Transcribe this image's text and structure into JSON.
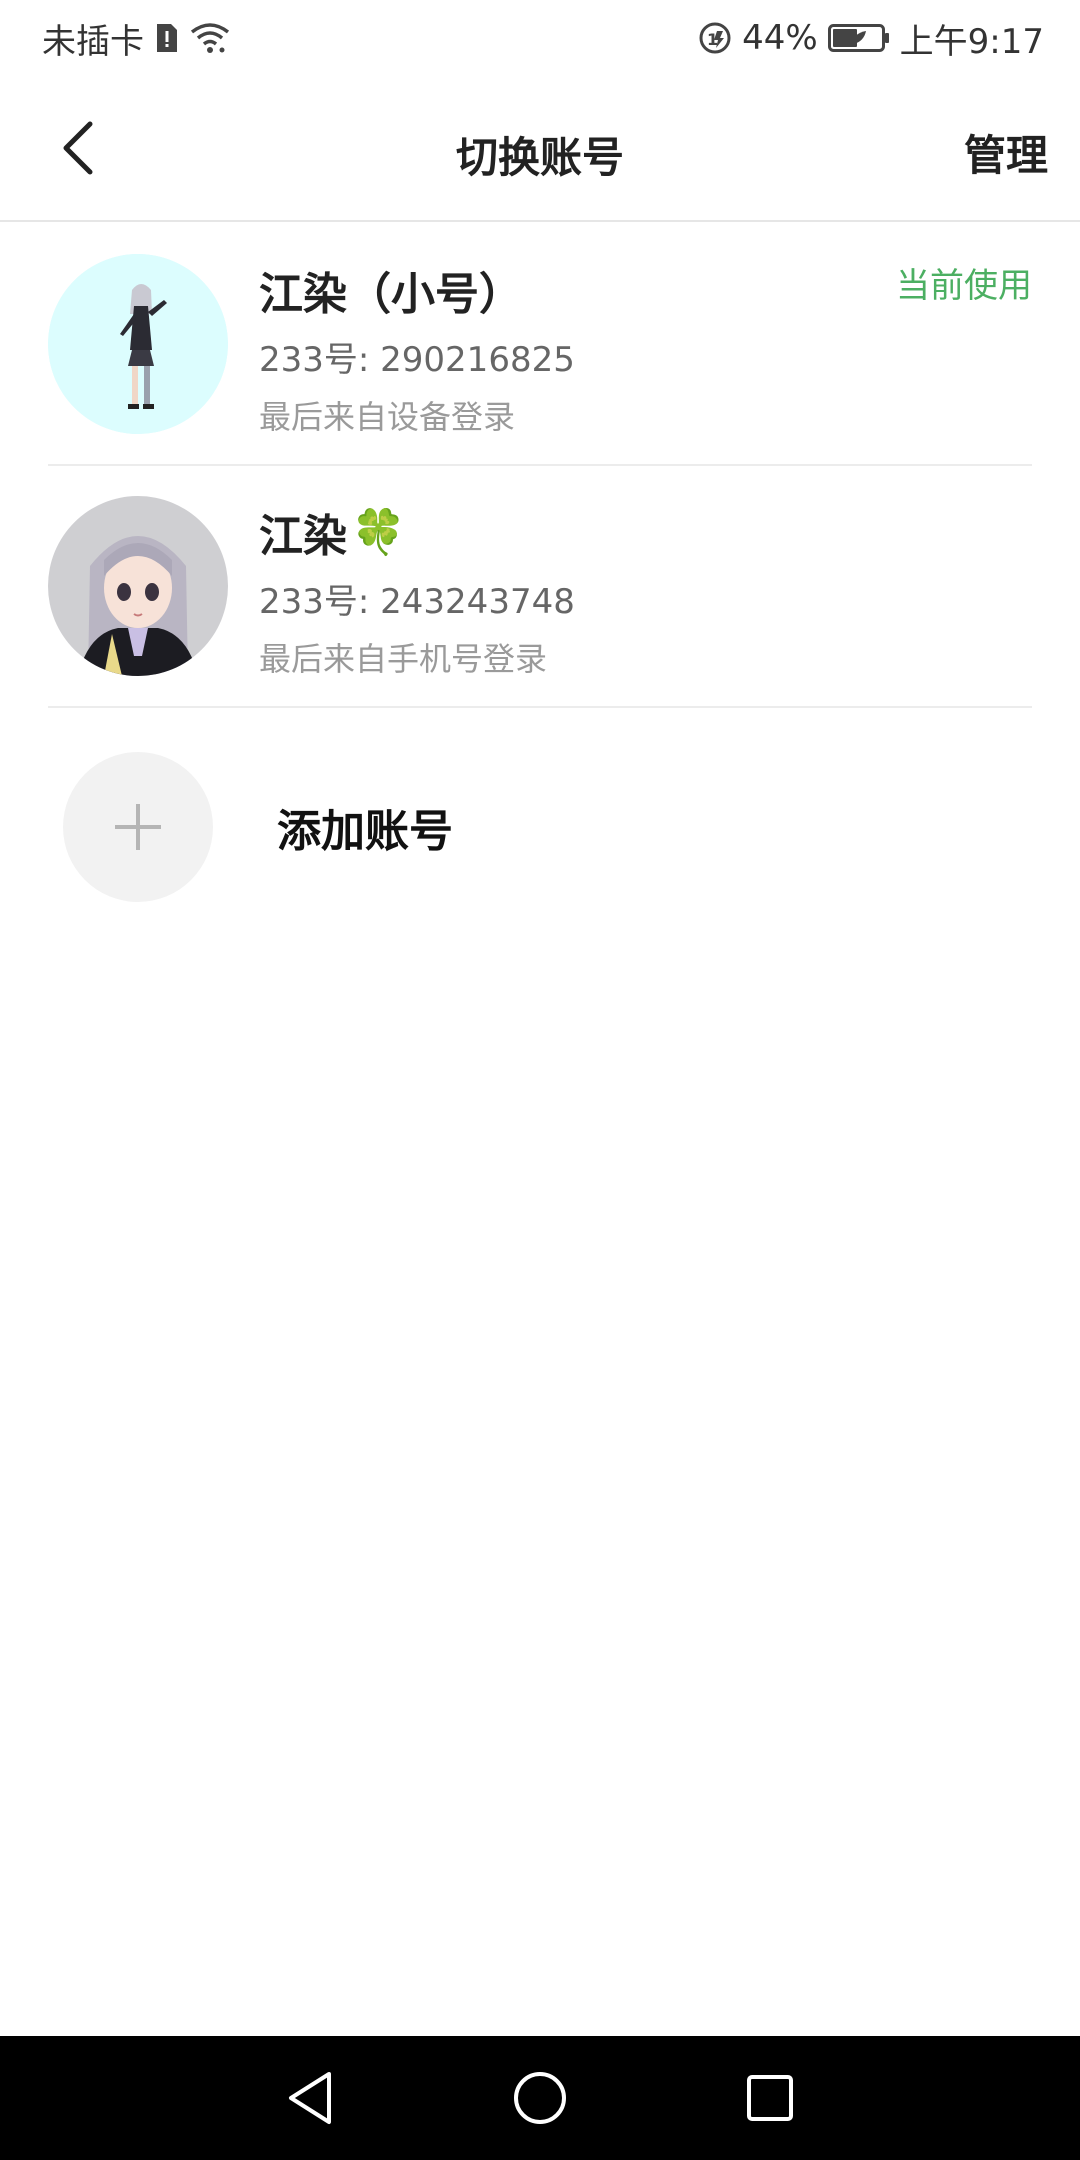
{
  "status_bar": {
    "carrier": "未插卡",
    "battery_percent": "44%",
    "time": "上午9:17",
    "icons": [
      "sim-icon",
      "wifi-icon",
      "data-saver-icon",
      "battery-icon"
    ]
  },
  "nav": {
    "title": "切换账号",
    "manage_label": "管理",
    "back_icon": "back-arrow-icon"
  },
  "accounts": [
    {
      "name": "江染（小号）",
      "id_text": "233号: 290216825",
      "login_text": "最后来自设备登录",
      "current_label": "当前使用",
      "avatar": "character-avatar-full-body"
    },
    {
      "name": "江染",
      "name_emoji": "🍀",
      "id_text": "233号: 243243748",
      "login_text": "最后来自手机号登录",
      "avatar": "character-avatar-portrait"
    }
  ],
  "add_account": {
    "label": "添加账号",
    "icon": "plus-icon"
  },
  "system_nav": [
    "back-triangle-icon",
    "home-circle-icon",
    "recents-square-icon"
  ],
  "colors": {
    "accent_green": "#4caf62",
    "divider": "#ececec",
    "text_primary": "#222222",
    "text_secondary": "#666666",
    "text_tertiary": "#9a9a9a"
  }
}
